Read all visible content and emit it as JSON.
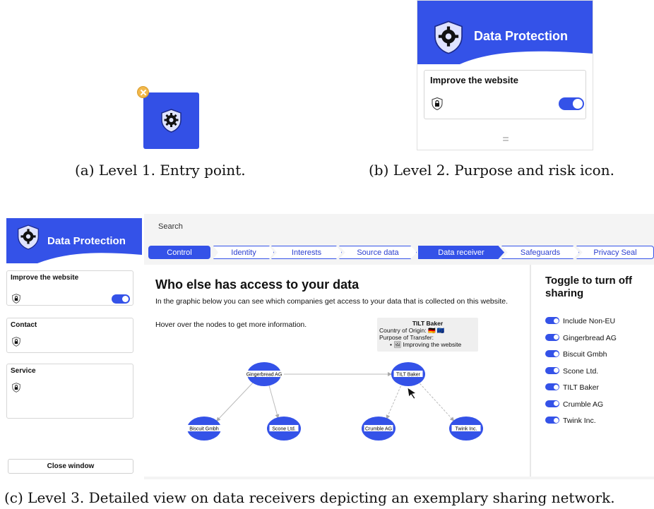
{
  "entry": {
    "shield_icon": "gear-shield-icon",
    "badge_icon": "close-icon",
    "caption": "(a) Level 1. Entry point."
  },
  "level2": {
    "title": "Data Protection",
    "purpose": "Improve the website",
    "risk_icon": "lock-shield-icon",
    "toggle_on": true,
    "handle": "=",
    "caption": "(b) Level 2. Purpose and risk icon."
  },
  "level3": {
    "title": "Data Protection",
    "purposes": [
      {
        "label": "Improve the website",
        "toggle": true
      },
      {
        "label": "Contact",
        "toggle": false
      },
      {
        "label": "Service",
        "toggle": false
      }
    ],
    "close_button": "Close window",
    "search_label": "Search",
    "tabs": [
      {
        "label": "Control",
        "active": true
      },
      {
        "label": "Identity",
        "active": false
      },
      {
        "label": "Interests",
        "active": false
      },
      {
        "label": "Source data",
        "active": false
      },
      {
        "label": "Data receiver",
        "active": true
      },
      {
        "label": "Safeguards",
        "active": false
      },
      {
        "label": "Privacy Seal",
        "active": false
      }
    ],
    "content": {
      "title": "Who else has access to your data",
      "description": "In the graphic below you can see which companies get access to your data that is collected on this website.",
      "hint": "Hover over the nodes to get more information."
    },
    "tooltip": {
      "title": "TILT Baker",
      "origin": "Country of Origin: 🇩🇪 🇪🇺",
      "purpose_label": "Purpose of Transfer:",
      "purpose": "• 🖼 Improving the website"
    },
    "graph": {
      "nodes": [
        "Gingerbread AG",
        "TILT Baker",
        "Biscuit Gmbh",
        "Scone Ltd.",
        "Crumble AG",
        "Twink Inc."
      ],
      "edges": [
        {
          "from": "Gingerbread AG",
          "to": "TILT Baker",
          "style": "solid"
        },
        {
          "from": "Gingerbread AG",
          "to": "Biscuit Gmbh",
          "style": "solid"
        },
        {
          "from": "Gingerbread AG",
          "to": "Scone Ltd.",
          "style": "solid"
        },
        {
          "from": "TILT Baker",
          "to": "Crumble AG",
          "style": "dashed"
        },
        {
          "from": "TILT Baker",
          "to": "Twink Inc.",
          "style": "dashed"
        }
      ]
    },
    "toggle_panel": {
      "title": "Toggle to turn off sharing",
      "items": [
        "Include Non-EU",
        "Gingerbread AG",
        "Biscuit Gmbh",
        "Scone Ltd.",
        "TILT Baker",
        "Crumble AG",
        "Twink Inc."
      ]
    },
    "caption": "(c) Level 3. Detailed view on data receivers depicting an exemplary sharing network."
  },
  "colors": {
    "accent": "#3452e8",
    "badge": "#f2b84b"
  }
}
